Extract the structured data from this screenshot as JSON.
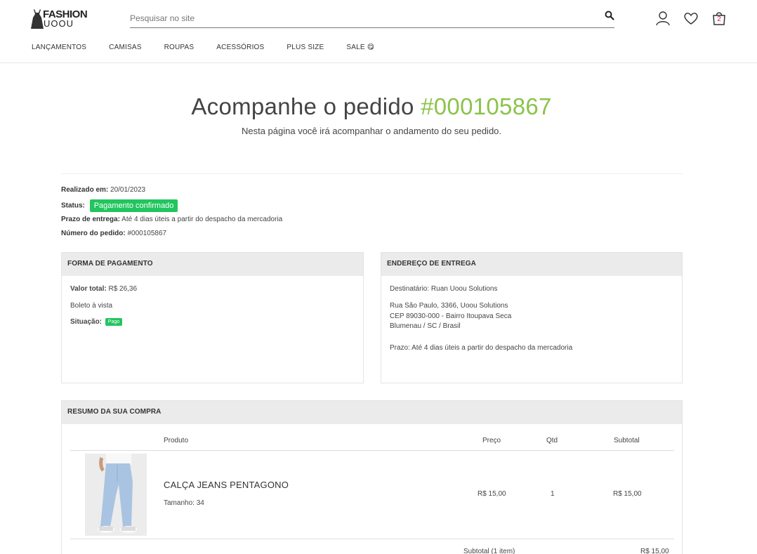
{
  "header": {
    "logo_top": "FASHION",
    "logo_bottom": "UOOU",
    "search_placeholder": "Pesquisar no site",
    "cart_count": "2",
    "icons": [
      "search-icon",
      "user-icon",
      "heart-icon",
      "cart-icon"
    ]
  },
  "nav": {
    "items": [
      "LANÇAMENTOS",
      "CAMISAS",
      "ROUPAS",
      "ACESSÓRIOS",
      "PLUS SIZE",
      "SALE 😋"
    ]
  },
  "page": {
    "title_prefix": "Acompanhe o pedido ",
    "order_number": "#000105867",
    "subtitle": "Nesta página você irá acompanhar o andamento do seu pedido."
  },
  "order_info": {
    "realizado_label": "Realizado em:",
    "realizado_value": "20/01/2023",
    "status_label": "Status:",
    "status_value": "Pagamento confirmado",
    "prazo_label": "Prazo de entrega:",
    "prazo_value": "Até 4 dias úteis a partir do despacho da mercadoria",
    "numero_label": "Número do pedido:",
    "numero_value": "#000105867"
  },
  "payment": {
    "heading": "FORMA DE PAGAMENTO",
    "valor_label": "Valor total:",
    "valor_value": "R$ 26,36",
    "method": "Boleto à vista",
    "situacao_label": "Situação:",
    "situacao_value": "Pago"
  },
  "delivery": {
    "heading": "ENDEREÇO DE ENTREGA",
    "recipient": "Destinatário: Ruan Uoou Solutions",
    "address_line1": "Rua São Paulo, 3366, Uoou Solutions",
    "address_line2": "CEP 89030-000 - Bairro Itoupava Seca",
    "address_line3": "Blumenau / SC / Brasil",
    "prazo": "Prazo: Até 4 dias úteis a partir do despacho da mercadoria"
  },
  "summary": {
    "heading": "RESUMO DA SUA COMPRA",
    "columns": [
      "Produto",
      "Preço",
      "Qtd",
      "Subtotal"
    ],
    "items": [
      {
        "name": "CALÇA JEANS PENTAGONO",
        "size": "Tamanho: 34",
        "price": "R$ 15,00",
        "qty": "1",
        "subtotal": "R$ 15,00"
      }
    ],
    "subtotal_label": "Subtotal (1 item)",
    "subtotal_value": "R$ 15,00"
  },
  "colors": {
    "accent_green": "#8bc34a",
    "badge_green": "#22c55e",
    "cart_badge": "#c2185b"
  }
}
